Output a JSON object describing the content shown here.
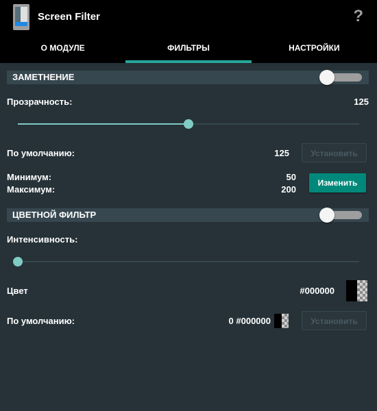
{
  "app": {
    "title": "Screen Filter",
    "icon": "phone-icon",
    "help_label": "?"
  },
  "tabs": [
    {
      "label": "О МОДУЛЕ",
      "active": false
    },
    {
      "label": "ФИЛЬТРЫ",
      "active": true
    },
    {
      "label": "НАСТРОЙКИ",
      "active": false
    }
  ],
  "dimming": {
    "title": "ЗАМЕТНЕНИЕ",
    "enabled": false,
    "opacity_label": "Прозрачность:",
    "opacity_value": "125",
    "opacity_level_fraction": 0.5,
    "default_label": "По умолчанию:",
    "default_value": "125",
    "set_button": "Установить",
    "min_label": "Минимум:",
    "min_value": "50",
    "max_label": "Максимум:",
    "max_value": "200",
    "change_button": "Изменить"
  },
  "color_filter": {
    "title": "ЦВЕТНОЙ ФИЛЬТР",
    "enabled": false,
    "intensity_label": "Интенсивность:",
    "intensity_level_fraction": 0,
    "color_label": "Цвет",
    "color_value": "#000000",
    "default_label": "По умолчанию:",
    "default_value": "0 #000000",
    "set_button": "Установить"
  },
  "colors": {
    "accent": "#26a69a",
    "slider": "#80cbc4",
    "background": "#263238",
    "section_header": "#37474f",
    "primary_button": "#00897b"
  }
}
